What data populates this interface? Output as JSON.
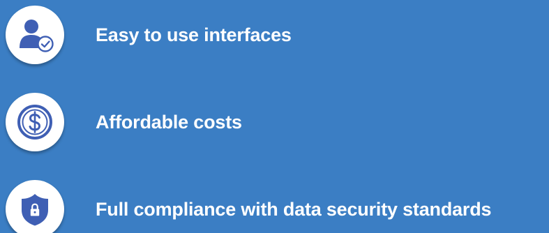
{
  "colors": {
    "background": "#3b7ec4",
    "icon": "#3f5fb4",
    "badge": "#ffffff",
    "text": "#ffffff"
  },
  "features": [
    {
      "icon": "user-check-icon",
      "label": "Easy to use interfaces"
    },
    {
      "icon": "dollar-circle-icon",
      "label": "Affordable costs"
    },
    {
      "icon": "shield-lock-icon",
      "label": "Full compliance with data security standards"
    }
  ]
}
